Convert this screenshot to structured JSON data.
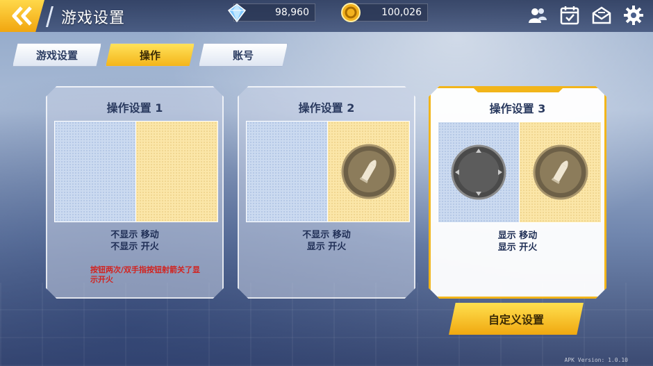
{
  "header": {
    "title": "游戏设置",
    "gems": "98,960",
    "coins": "100,026",
    "icons": [
      "friends-icon",
      "checkin-calendar-icon",
      "mail-icon",
      "settings-gear-icon"
    ]
  },
  "tabs": [
    {
      "label": "游戏设置",
      "active": false
    },
    {
      "label": "操作",
      "active": true
    },
    {
      "label": "账号",
      "active": false
    }
  ],
  "cards": [
    {
      "title": "操作设置 1",
      "line1": "不显示 移动",
      "line2": "不显示 开火",
      "note": "按钮两次/双手指按钮射箭关了显示开火",
      "selected": false
    },
    {
      "title": "操作设置 2",
      "line1": "不显示 移动",
      "line2": "显示 开火",
      "selected": false
    },
    {
      "title": "操作设置 3",
      "line1": "显示 移动",
      "line2": "显示 开火",
      "selected": true
    }
  ],
  "custom_button": "自定义设置",
  "version": "APK Version: 1.0.10",
  "colors": {
    "accent": "#f2b51a",
    "note_red": "#d2231f",
    "title_text": "#2a3a5f"
  }
}
